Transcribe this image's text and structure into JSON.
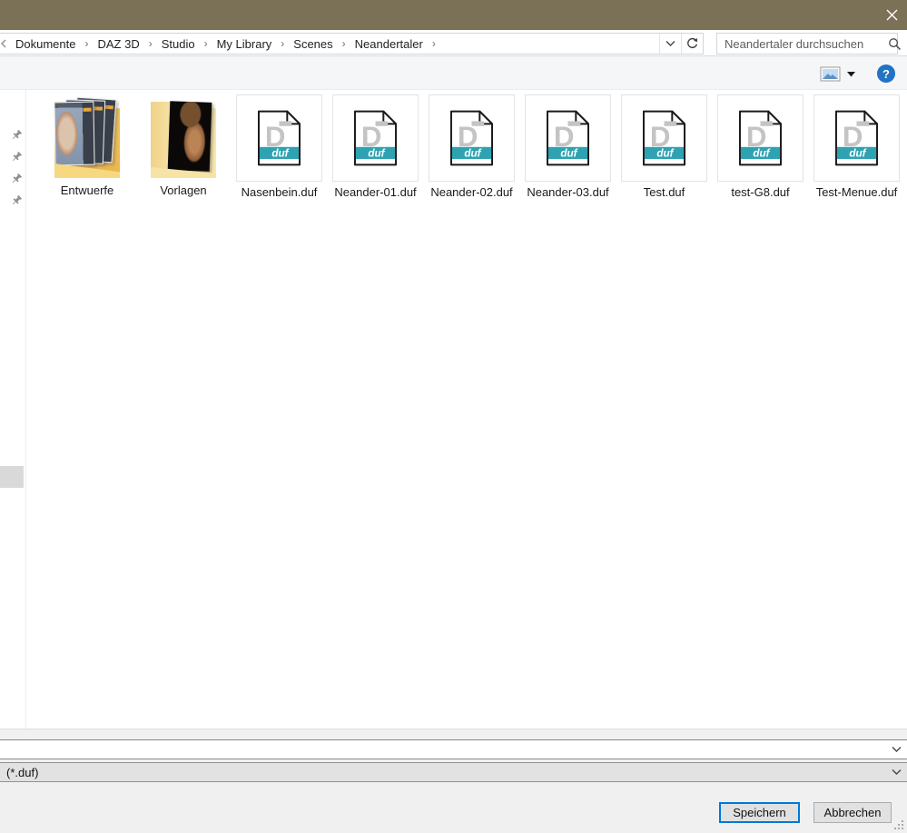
{
  "titlebar": {
    "title": ""
  },
  "address_bar": {
    "breadcrumb": [
      "Dokumente",
      "DAZ 3D",
      "Studio",
      "My Library",
      "Scenes",
      "Neandertaler"
    ],
    "separator": "›"
  },
  "search": {
    "placeholder": "Neandertaler durchsuchen"
  },
  "toolbar": {
    "help_glyph": "?"
  },
  "files_area": {
    "folders": [
      {
        "name": "Entwuerfe"
      },
      {
        "name": "Vorlagen"
      }
    ],
    "files": [
      {
        "name": "Nasenbein.duf"
      },
      {
        "name": "Neander-01.duf"
      },
      {
        "name": "Neander-02.duf"
      },
      {
        "name": "Neander-03.duf"
      },
      {
        "name": "Test.duf"
      },
      {
        "name": "test-G8.duf"
      },
      {
        "name": "Test-Menue.duf"
      }
    ],
    "duf_letter": "D",
    "duf_badge": "duf"
  },
  "footer": {
    "filename_value": "",
    "filetype_value": "(*.duf)",
    "save_label": "Speichern",
    "cancel_label": "Abbrechen"
  },
  "colors": {
    "titlebar": "#7a7157",
    "accent": "#0078d7",
    "duf-teal": "#2fa2b1"
  }
}
